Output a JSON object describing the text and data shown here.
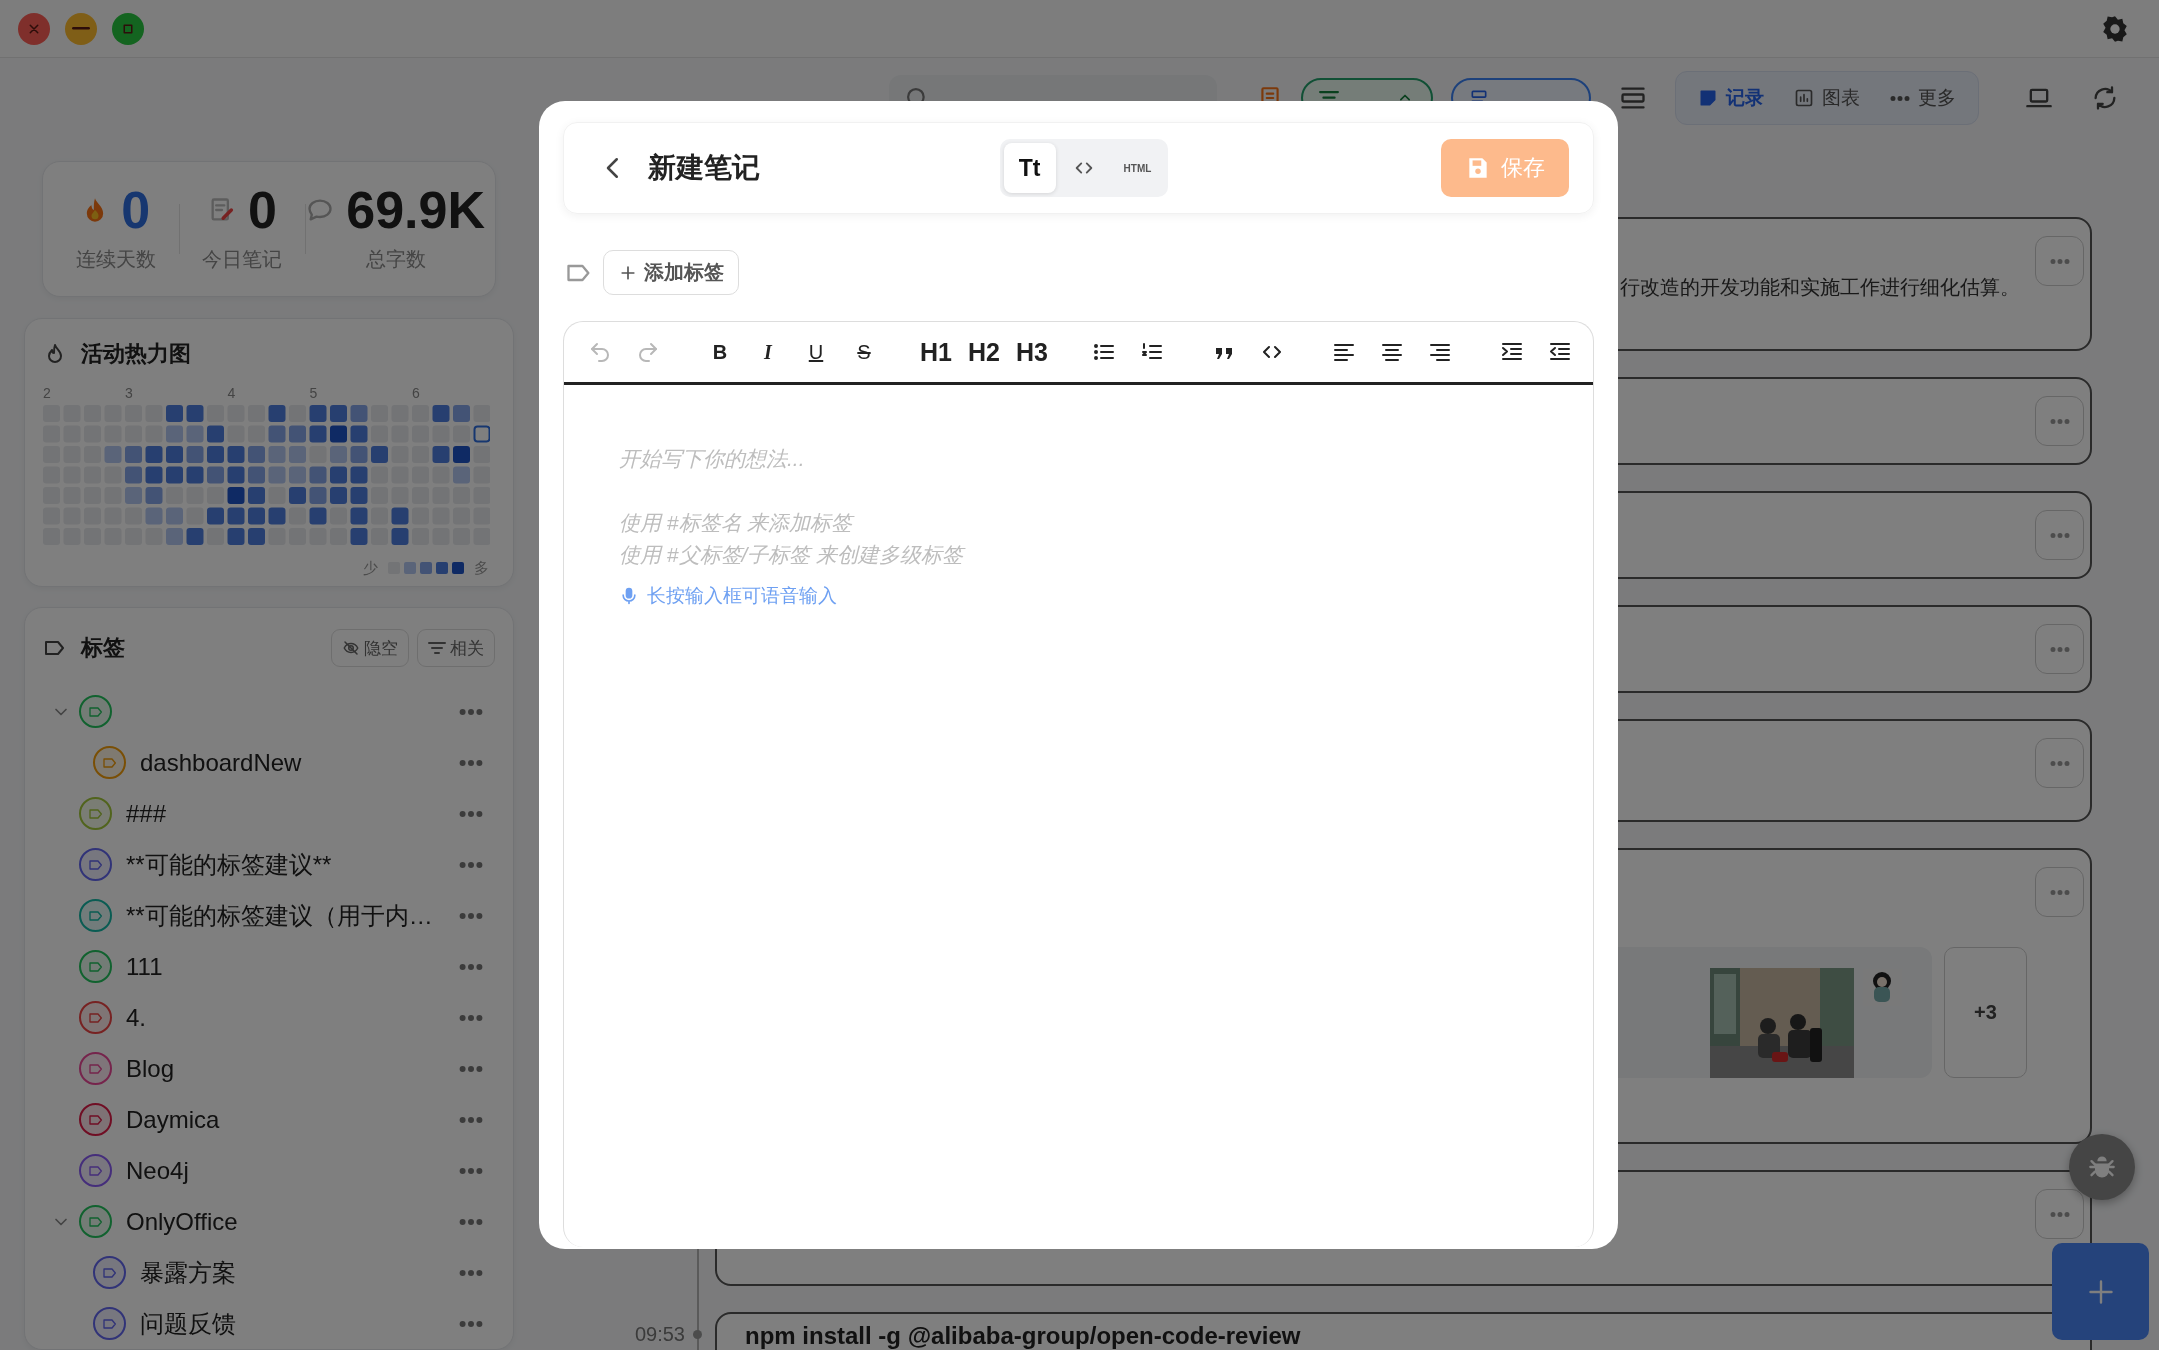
{
  "window": {
    "controls": [
      {
        "kind": "close"
      },
      {
        "kind": "minimize"
      },
      {
        "kind": "maximize"
      }
    ]
  },
  "toolbar": {
    "view_tabs": [
      {
        "kind": "record",
        "label": "记录",
        "selected": true
      },
      {
        "kind": "chart",
        "label": "图表",
        "selected": false
      },
      {
        "kind": "more",
        "label": "更多",
        "selected": false
      }
    ]
  },
  "stats": [
    {
      "kind": "streak",
      "value": "0",
      "label": "连续天数"
    },
    {
      "kind": "today",
      "value": "0",
      "label": "今日笔记"
    },
    {
      "kind": "words",
      "value": "69.9K",
      "label": "总字数"
    }
  ],
  "heatmap": {
    "title": "活动热力图",
    "months": [
      "2",
      "3",
      "4",
      "5",
      "6"
    ],
    "legend_low": "少",
    "legend_high": "多"
  },
  "tags": {
    "title": "标签",
    "buttons": [
      {
        "kind": "hide-empty",
        "label": "隐空"
      },
      {
        "kind": "related",
        "label": "相关"
      }
    ],
    "items": [
      {
        "color": "#11622f",
        "expanded": true,
        "children": [
          {
            "label": "dashboardNew",
            "color": "#7a4f05"
          }
        ]
      },
      {
        "label": "###",
        "color": "#51641d"
      },
      {
        "label": "**可能的标签建议**",
        "color": "#313378"
      },
      {
        "label": "**可能的标签建议（用于内…",
        "color": "#0a5c53"
      },
      {
        "label": "111",
        "color": "#11622f"
      },
      {
        "label": "4.",
        "color": "#772222"
      },
      {
        "label": "Blog",
        "color": "#76244c"
      },
      {
        "label": "Daymica",
        "color": "#700e24"
      },
      {
        "label": "Neo4j",
        "color": "#452e7b"
      },
      {
        "label": "OnlyOffice",
        "color": "#11622f",
        "expanded": true,
        "children": [
          {
            "label": "暴露方案",
            "color": "#313378"
          },
          {
            "label": "问题反馈",
            "color": "#313378"
          }
        ]
      }
    ]
  },
  "timeline": {
    "cards": [
      {
        "kind": "text",
        "text": "行改造的开发功能和实施工作进行细化估算。"
      },
      {
        "kind": "blank"
      },
      {
        "kind": "blank"
      },
      {
        "kind": "blank"
      },
      {
        "kind": "blank"
      },
      {
        "kind": "attachments",
        "more": "+3"
      },
      {
        "kind": "blank"
      },
      {
        "kind": "command",
        "time": "09:53",
        "text": "npm install -g @alibaba-group/open-code-review"
      }
    ]
  },
  "modal": {
    "title": "新建笔记",
    "modes": [
      {
        "kind": "rich",
        "label": "Tt",
        "selected": true
      },
      {
        "kind": "code",
        "selected": false
      },
      {
        "kind": "html",
        "label": "HTML",
        "selected": false
      }
    ],
    "save": {
      "label": "保存",
      "disabled": true
    },
    "add_tag": "添加标签",
    "toolbar": [
      [
        {
          "kind": "undo",
          "disabled": true
        },
        {
          "kind": "redo",
          "disabled": true
        }
      ],
      [
        {
          "kind": "bold",
          "label": "B",
          "disabled": false
        },
        {
          "kind": "italic",
          "label": "I",
          "disabled": false
        },
        {
          "kind": "underline",
          "label": "U",
          "disabled": false
        },
        {
          "kind": "strike",
          "label": "S",
          "disabled": false
        }
      ],
      [
        {
          "kind": "heading",
          "label": "H1",
          "disabled": false
        },
        {
          "kind": "heading",
          "label": "H2",
          "disabled": false
        },
        {
          "kind": "heading",
          "label": "H3",
          "disabled": false
        }
      ],
      [
        {
          "kind": "bullet-list",
          "disabled": false
        },
        {
          "kind": "ordered-list",
          "disabled": false
        }
      ],
      [
        {
          "kind": "quote",
          "disabled": false
        },
        {
          "kind": "code",
          "disabled": false
        }
      ],
      [
        {
          "kind": "align-left",
          "disabled": false
        },
        {
          "kind": "align-center",
          "disabled": false
        },
        {
          "kind": "align-right",
          "disabled": false
        }
      ],
      [
        {
          "kind": "indent",
          "disabled": false
        },
        {
          "kind": "outdent",
          "disabled": false
        }
      ]
    ],
    "editor": {
      "placeholder": "开始写下你的想法...",
      "help_lines": [
        "使用 #标签名 来添加标签",
        "使用 #父标签/子标签 来创建多级标签"
      ],
      "voice_hint": "长按输入框可语音输入"
    }
  }
}
